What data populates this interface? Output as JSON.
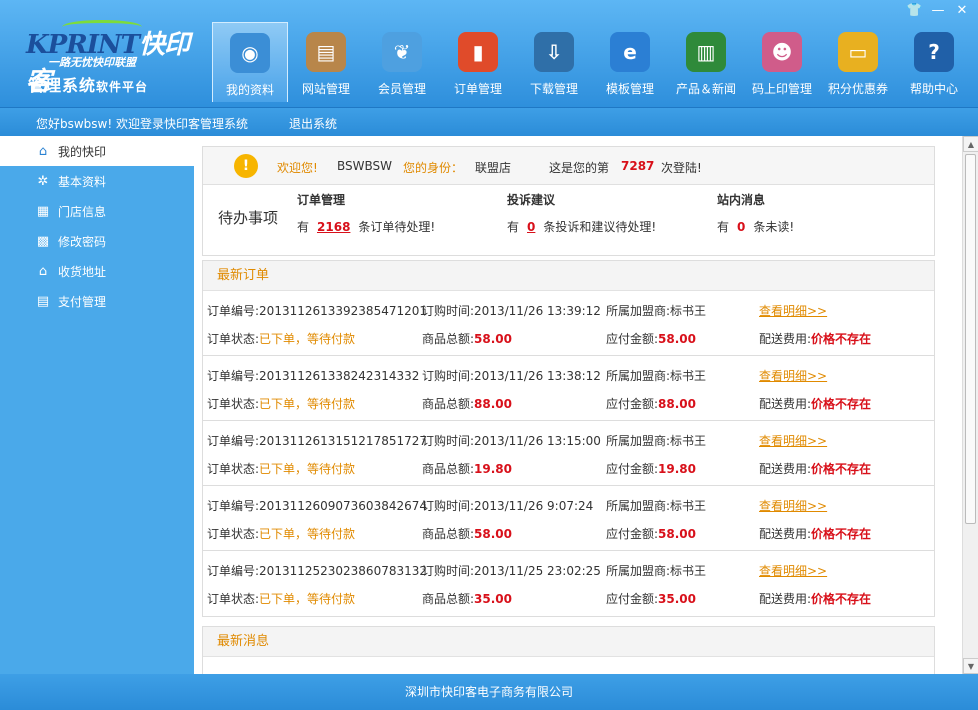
{
  "logo": {
    "brand": "KPRINT",
    "brand_cn": "快印客",
    "slogan": "一路无忧快印联盟",
    "title": "管理系统",
    "title_small": "软件平台"
  },
  "nav": [
    {
      "label": "我的资料",
      "icon": "globe-cursor-icon",
      "color": "#3b8ed6"
    },
    {
      "label": "网站管理",
      "icon": "box-icon",
      "color": "#b8864a"
    },
    {
      "label": "会员管理",
      "icon": "butterfly-icon",
      "color": "#4ea0e0"
    },
    {
      "label": "订单管理",
      "icon": "bar-chart-icon",
      "color": "#e04b2a"
    },
    {
      "label": "下载管理",
      "icon": "download-icon",
      "color": "#2f6fa8"
    },
    {
      "label": "模板管理",
      "icon": "ie-icon",
      "color": "#2b7fd4"
    },
    {
      "label": "产品＆新闻",
      "icon": "books-icon",
      "color": "#2f8a3a"
    },
    {
      "label": "码上印管理",
      "icon": "person-card-icon",
      "color": "#d05c8a"
    },
    {
      "label": "积分优惠券",
      "icon": "card-icon",
      "color": "#e8b020"
    },
    {
      "label": "帮助中心",
      "icon": "help-icon",
      "color": "#2060a8"
    }
  ],
  "subbar": {
    "greeting": "您好bswbsw! 欢迎登录快印客管理系统",
    "logout": "退出系统"
  },
  "sidebar": [
    {
      "label": "我的快印",
      "icon": "home-icon"
    },
    {
      "label": "基本资料",
      "icon": "gear-icon"
    },
    {
      "label": "门店信息",
      "icon": "grid-icon"
    },
    {
      "label": "修改密码",
      "icon": "keypad-icon"
    },
    {
      "label": "收货地址",
      "icon": "house-icon"
    },
    {
      "label": "支付管理",
      "icon": "document-icon"
    }
  ],
  "welcome": {
    "welcome_label": "欢迎您!",
    "username": "BSWBSW",
    "identity_label": "您的身份：",
    "identity": "联盟店",
    "login_prefix": "这是您的第",
    "login_count": "7287",
    "login_suffix": "次登陆!"
  },
  "todo": {
    "title": "待办事项",
    "order_head": "订单管理",
    "order_pre": "有",
    "order_count": "2168",
    "order_post": "条订单待处理!",
    "complaint_head": "投诉建议",
    "complaint_pre": "有",
    "complaint_count": "0",
    "complaint_post": "条投诉和建议待处理!",
    "msg_head": "站内消息",
    "msg_pre": "有",
    "msg_count": "0",
    "msg_post": "条未读!"
  },
  "orders_panel": {
    "title": "最新订单",
    "labels": {
      "no": "订单编号:",
      "time": "订购时间:",
      "shop": "所属加盟商:",
      "status": "订单状态:",
      "total": "商品总额:",
      "pay": "应付金额:",
      "ship": "配送费用:"
    },
    "detail_link": "查看明细>>",
    "orders": [
      {
        "no": "20131126133923854712​01",
        "time": "2013/11/26 13:39:12",
        "shop": "标书王",
        "status": "已下单，等待付款",
        "total": "58.00",
        "pay": "58.00",
        "ship": "价格不存在"
      },
      {
        "no": "2013112613382423143​32",
        "time": "2013/11/26 13:38:12",
        "shop": "标书王",
        "status": "已下单，等待付款",
        "total": "88.00",
        "pay": "88.00",
        "ship": "价格不存在"
      },
      {
        "no": "20131126131512178517​27",
        "time": "2013/11/26 13:15:00",
        "shop": "标书王",
        "status": "已下单，等待付款",
        "total": "19.80",
        "pay": "19.80",
        "ship": "价格不存在"
      },
      {
        "no": "20131126090736038426​74",
        "time": "2013/11/26 9:07:24",
        "shop": "标书王",
        "status": "已下单，等待付款",
        "total": "58.00",
        "pay": "58.00",
        "ship": "价格不存在"
      },
      {
        "no": "20131125230238607831​32",
        "time": "2013/11/25 23:02:25",
        "shop": "标书王",
        "status": "已下单，等待付款",
        "total": "35.00",
        "pay": "35.00",
        "ship": "价格不存在"
      }
    ]
  },
  "news_panel": {
    "title": "最新消息"
  },
  "footer": {
    "text": "深圳市快印客电子商务有限公司"
  },
  "window_controls": {
    "skin": "👕",
    "minimize": "—",
    "close": "✕"
  },
  "colors": {
    "header": "#3a9be3",
    "accent": "#e08a00",
    "alert": "#d8101a"
  }
}
